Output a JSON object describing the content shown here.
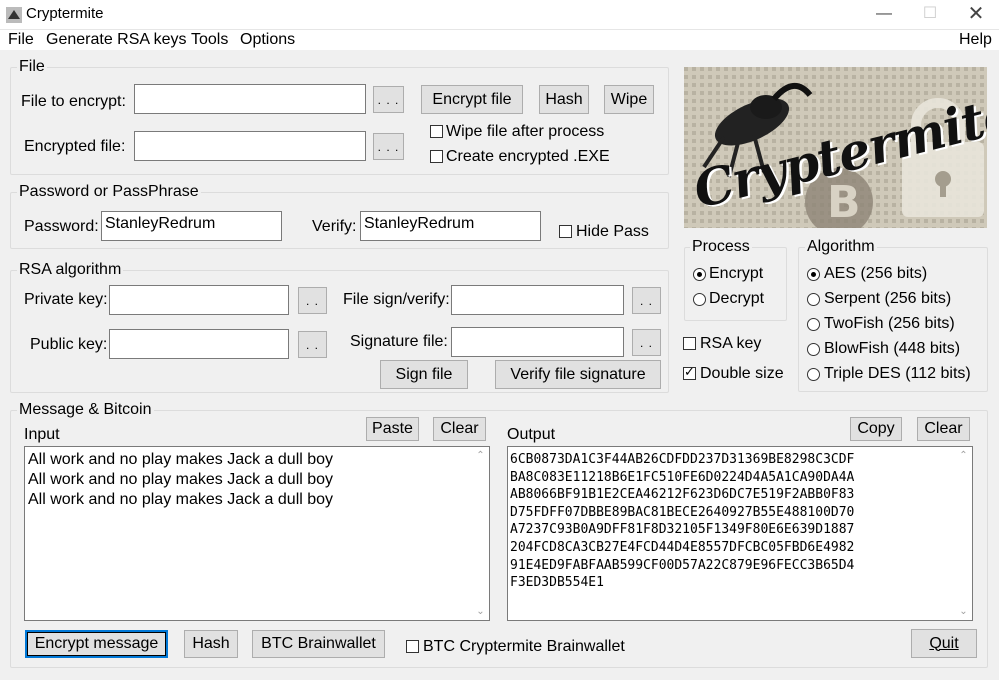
{
  "window": {
    "title": "Cryptermite"
  },
  "menu": {
    "file": "File",
    "generate_rsa": "Generate RSA keys",
    "tools": "Tools",
    "options": "Options",
    "help": "Help"
  },
  "file_group": {
    "title": "File",
    "file_to_encrypt_label": "File to encrypt:",
    "file_to_encrypt_value": "",
    "encrypted_file_label": "Encrypted file:",
    "encrypted_file_value": "",
    "browse_label": ". . .",
    "encrypt_file_btn": "Encrypt file",
    "hash_btn": "Hash",
    "wipe_btn": "Wipe",
    "wipe_after_label": "Wipe file after process",
    "wipe_after_checked": false,
    "create_exe_label": "Create encrypted .EXE",
    "create_exe_checked": false
  },
  "password_group": {
    "title": "Password or PassPhrase",
    "password_label": "Password:",
    "password_value": "StanleyRedrum",
    "verify_label": "Verify:",
    "verify_value": "StanleyRedrum",
    "hide_pass_label": "Hide Pass",
    "hide_pass_checked": false
  },
  "rsa_group": {
    "title": "RSA algorithm",
    "private_key_label": "Private key:",
    "public_key_label": "Public key:",
    "file_sign_label": "File sign/verify:",
    "signature_file_label": "Signature file:",
    "browse_small": ". .",
    "sign_file_btn": "Sign file",
    "verify_sig_btn": "Verify file signature"
  },
  "logo": {
    "text": "Cryptermite"
  },
  "process_group": {
    "title": "Process",
    "options": [
      "Encrypt",
      "Decrypt"
    ],
    "selected": "Encrypt"
  },
  "extra_options": {
    "rsa_key_label": "RSA key",
    "rsa_key_checked": false,
    "double_size_label": "Double size",
    "double_size_checked": true
  },
  "algorithm_group": {
    "title": "Algorithm",
    "options": [
      "AES (256 bits)",
      "Serpent (256 bits)",
      "TwoFish (256 bits)",
      "BlowFish (448 bits)",
      "Triple DES (112 bits)"
    ],
    "selected": "AES (256 bits)"
  },
  "message_group": {
    "title": "Message & Bitcoin",
    "input_label": "Input",
    "paste_btn": "Paste",
    "clear_btn": "Clear",
    "input_lines": [
      "All work and no play makes Jack a dull boy",
      "All work and no play makes Jack a dull boy",
      "All work and no play makes Jack a dull boy"
    ],
    "output_label": "Output",
    "copy_btn": "Copy",
    "output_lines": [
      "6CB0873DA1C3F44AB26CDFDD237D31369BE8298C3CDF",
      "BA8C083E11218B6E1FC510FE6D0224D4A5A1CA90DA4A",
      "AB8066BF91B1E2CEA46212F623D6DC7E519F2ABB0F83",
      "D75FDFF07DBBE89BAC81BECE2640927B55E488100D70",
      "A7237C93B0A9DFF81F8D32105F1349F80E6E639D1887",
      "204FCD8CA3CB27E4FCD44D4E8557DFCBC05FBD6E4982",
      "91E4ED9FABFAAB599CF00D57A22C879E96FECC3B65D4",
      "F3ED3DB554E1"
    ],
    "encrypt_message_btn": "Encrypt message",
    "hash_btn": "Hash",
    "btc_brainwallet_btn": "BTC Brainwallet",
    "btc_cryptermite_label": "BTC Cryptermite Brainwallet",
    "btc_cryptermite_checked": false,
    "quit_btn": "Quit"
  }
}
